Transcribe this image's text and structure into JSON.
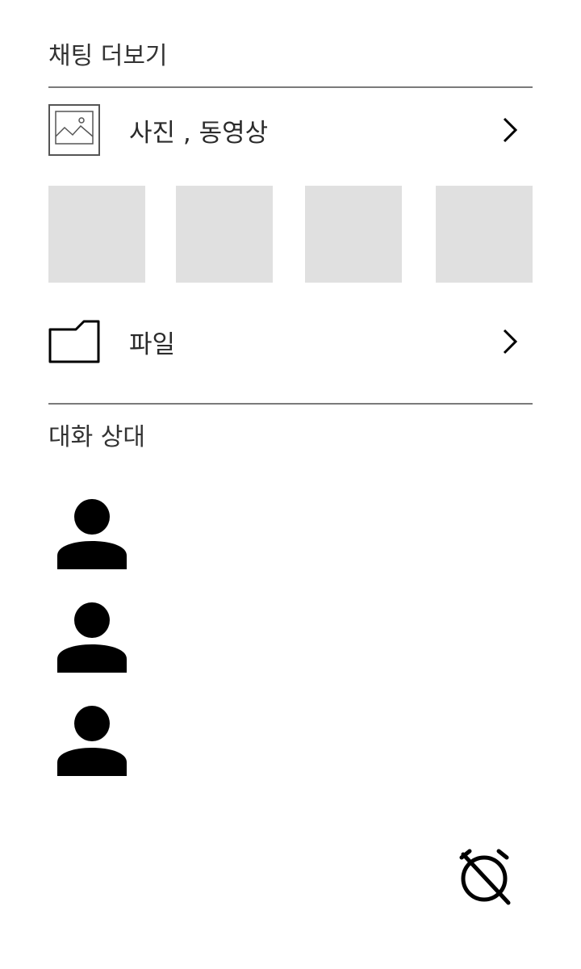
{
  "header": {
    "title": "채팅 더보기"
  },
  "media": {
    "label": "사진 , 동영상",
    "icon": "image-icon",
    "chevron_icon": "chevron-right-icon",
    "thumbnails": [
      {
        "name": "media-thumbnail-1"
      },
      {
        "name": "media-thumbnail-2"
      },
      {
        "name": "media-thumbnail-3"
      },
      {
        "name": "media-thumbnail-4"
      }
    ],
    "thumbnail_color": "#e0e0e0"
  },
  "files": {
    "label": "파일",
    "icon": "folder-icon",
    "chevron_icon": "chevron-right-icon"
  },
  "participants": {
    "title": "대화 상대",
    "members": [
      {
        "icon": "person-icon"
      },
      {
        "icon": "person-icon"
      },
      {
        "icon": "person-icon"
      }
    ]
  },
  "footer": {
    "timer_icon": "timer-off-icon"
  },
  "colors": {
    "divider": "#7a7a7a",
    "text": "#2b2b2b",
    "icon": "#000000"
  }
}
